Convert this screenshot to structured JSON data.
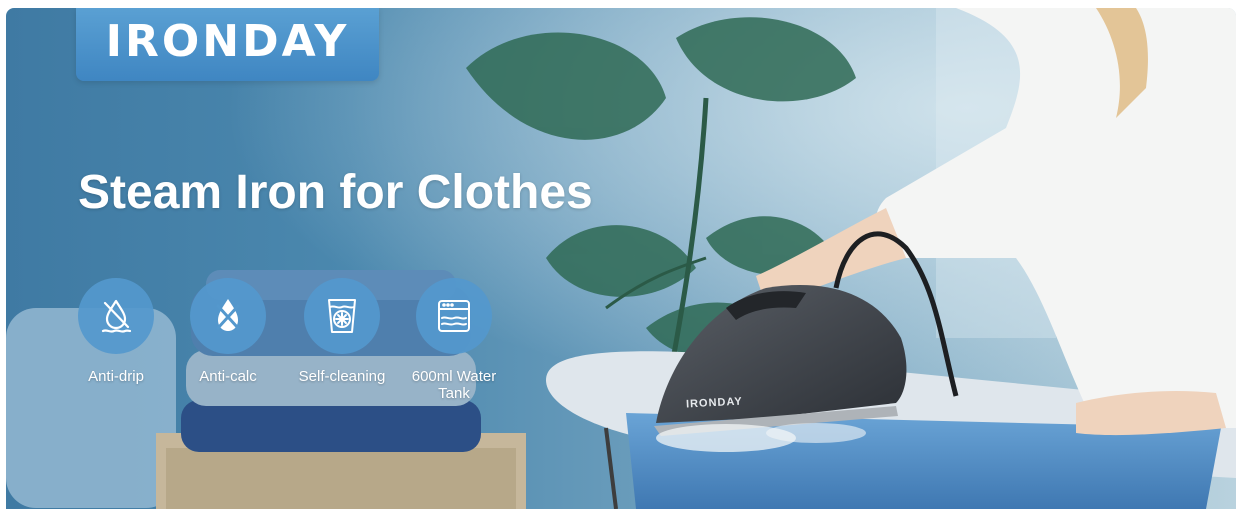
{
  "brand": {
    "logo_text": "IRONDAY",
    "plate_color": "#4a93cb"
  },
  "headline": "Steam Iron for Clothes",
  "features": [
    {
      "icon": "anti-drip-icon",
      "label": "Anti-drip"
    },
    {
      "icon": "anti-calc-icon",
      "label": "Anti-calc"
    },
    {
      "icon": "self-cleaning-icon",
      "label": "Self-cleaning"
    },
    {
      "icon": "water-tank-icon",
      "label": "600ml Water Tank"
    }
  ],
  "product": {
    "brand_label": "IRONDAY"
  },
  "colors": {
    "accent": "#4f97cf",
    "text": "#ffffff"
  }
}
